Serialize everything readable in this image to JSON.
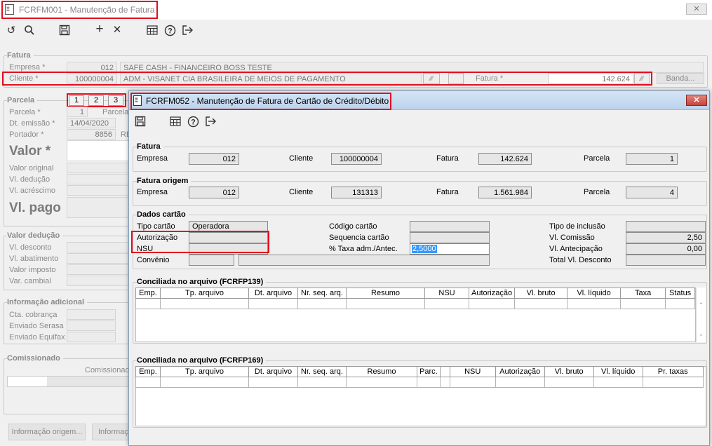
{
  "bg": {
    "title": "FCRFM001 - Manutenção de Fatura",
    "close": "✕",
    "fatura_section": "Fatura",
    "empresa_label": "Empresa *",
    "empresa_code": "012",
    "empresa_name": "SAFE CASH - FINANCEIRO BOSS TESTE",
    "cliente_label": "Cliente *",
    "cliente_code": "100000004",
    "cliente_name": "ADM - VISANET CIA BRASILEIRA DE MEIOS DE PAGAMENTO",
    "fatura_label": "Fatura *",
    "fatura_value": "142.624",
    "banda_button": "Banda...",
    "parcela_section": "Parcela",
    "parcela_tabs": [
      "1",
      "2",
      "3"
    ],
    "parcela_label": "Parcela *",
    "parcela_value": "1",
    "parcela_trunc": "Parcela",
    "dt_emissao_label": "Dt. emissão *",
    "dt_emissao_value": "14/04/2020",
    "portador_label": "Portador *",
    "portador_value": "8856",
    "portador_trunc": "RE",
    "valor_label": "Valor *",
    "valor_original_label": "Valor original",
    "vl_deducao_label": "Vl. dedução",
    "vl_acrescimo_label": "Vl. acréscimo",
    "vl_pago_label": "Vl. pago",
    "valor_deducao_section": "Valor dedução",
    "vl_desconto_label": "Vl. desconto",
    "vl_abatimento_label": "Vl. abatimento",
    "valor_imposto_label": "Valor imposto",
    "var_cambial_label": "Var. cambial",
    "info_adicional_section": "Informação adicional",
    "cta_cobranca_label": "Cta. cobrança",
    "enviado_serasa_label": "Enviado Serasa",
    "enviado_equifax_label": "Enviado Equifax",
    "comissionado_section": "Comissionado",
    "comissionado_col": "Comissionad",
    "info_origem_button": "Informação origem...",
    "info_trunc_button": "Informaç"
  },
  "dialog": {
    "title": "FCRFM052 - Manutenção de Fatura de Cartão de Crédito/Débito",
    "close": "✕",
    "fatura_section": "Fatura",
    "empresa_label": "Empresa",
    "empresa_value": "012",
    "cliente_label": "Cliente",
    "cliente_value": "100000004",
    "fatura_label": "Fatura",
    "fatura_value": "142.624",
    "parcela_label": "Parcela",
    "parcela_value": "1",
    "origem_section": "Fatura origem",
    "origem_empresa_value": "012",
    "origem_cliente_value": "131313",
    "origem_fatura_value": "1.561.984",
    "origem_parcela_value": "4",
    "dados_section": "Dados cartão",
    "tipo_cartao_label": "Tipo cartão",
    "tipo_cartao_value": "Operadora",
    "autorizacao_label": "Autorização",
    "nsu_label": "NSU",
    "convenio_label": "Convênio",
    "codigo_cartao_label": "Código cartão",
    "sequencia_cartao_label": "Sequencia cartão",
    "taxa_label": "% Taxa adm./Antec.",
    "taxa_value": "2,5000",
    "tipo_inclusao_label": "Tipo de inclusão",
    "vl_comissao_label": "Vl. Comissão",
    "vl_comissao_value": "2,50",
    "vl_antecipacao_label": "Vl. Antecipação",
    "vl_antecipacao_value": "0,00",
    "total_desconto_label": "Total Vl. Desconto",
    "grid1_title": "Conciliada no arquivo (FCRFP139)",
    "grid1_headers": [
      "Emp.",
      "Tp. arquivo",
      "Dt. arquivo",
      "Nr. seq. arq.",
      "Resumo",
      "NSU",
      "Autorização",
      "Vl. bruto",
      "Vl. líquido",
      "Taxa",
      "Status"
    ],
    "grid2_title": "Conciliada no arquivo (FCRFP169)",
    "grid2_headers": [
      "Emp.",
      "Tp. arquivo",
      "Dt. arquivo",
      "Nr. seq. arq.",
      "Resumo",
      "Parc.",
      "",
      "NSU",
      "Autorização",
      "Vl. bruto",
      "Vl. líquido",
      "Pr. taxas"
    ]
  },
  "icons": {
    "undo": "↺",
    "search": "🔍",
    "save": "💾",
    "add": "+",
    "delete": "✕",
    "calc": "▦",
    "help": "?",
    "exit": "⇥",
    "doc": "🗎"
  },
  "colors": {
    "highlight_red": "#e01020",
    "dialog_title_bg": "#c4daf0",
    "close_red": "#c7443a",
    "selection_blue": "#3399ff"
  }
}
